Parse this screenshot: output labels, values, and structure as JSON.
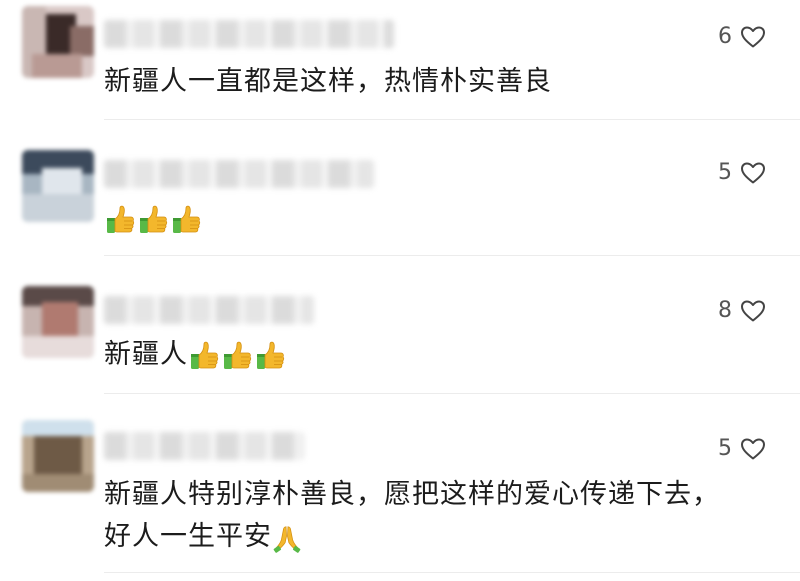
{
  "comments": [
    {
      "likes": "6",
      "text": "新疆人一直都是这样，热情朴实善良",
      "emoji_tail": ""
    },
    {
      "likes": "5",
      "text": "",
      "emoji_tail": "thumbs-up x3"
    },
    {
      "likes": "8",
      "text": "新疆人",
      "emoji_tail": "thumbs-up x3"
    },
    {
      "likes": "5",
      "text": "新疆人特别淳朴善良，愿把这样的爱心传递下去，",
      "text2": "好人一生平安",
      "emoji_tail": "folded-hands"
    }
  ],
  "icons": {
    "like": "heart-outline-icon",
    "thumbs": "thumbs-up-icon",
    "pray": "folded-hands-icon"
  },
  "colors": {
    "text": "#1c1c1c",
    "count": "#555555",
    "divider": "#ececec",
    "thumb": "#f3b72c",
    "cuff": "#58b947"
  }
}
